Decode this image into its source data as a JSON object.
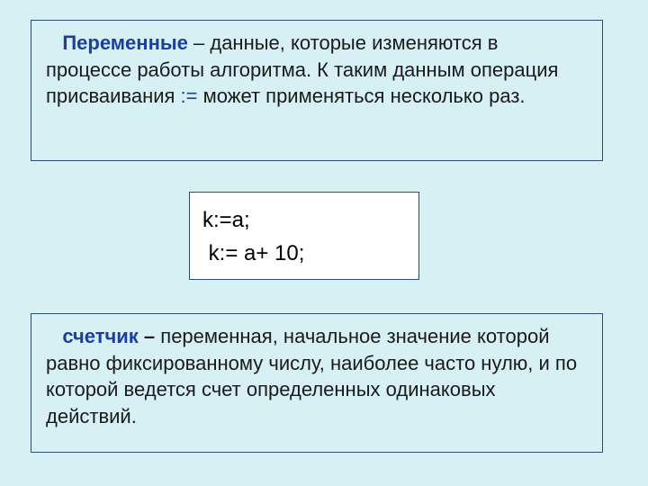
{
  "variables_box": {
    "term": "Переменные",
    "sep": " – ",
    "text_before_op": "данные, которые изменяются в процессе работы алгоритма. К таким данным операция присваивания ",
    "op": ":=",
    "text_after_op": " может применяться несколько раз."
  },
  "code_box": {
    "line1": "k:=a;",
    "line2": " k:= a+ 10;"
  },
  "counter_box": {
    "term": "счетчик",
    "sep": " – ",
    "text": "переменная, начальное значение которой равно фиксированному числу, наиболее часто нулю, и по которой ведется счет определенных одинаковых действий."
  }
}
